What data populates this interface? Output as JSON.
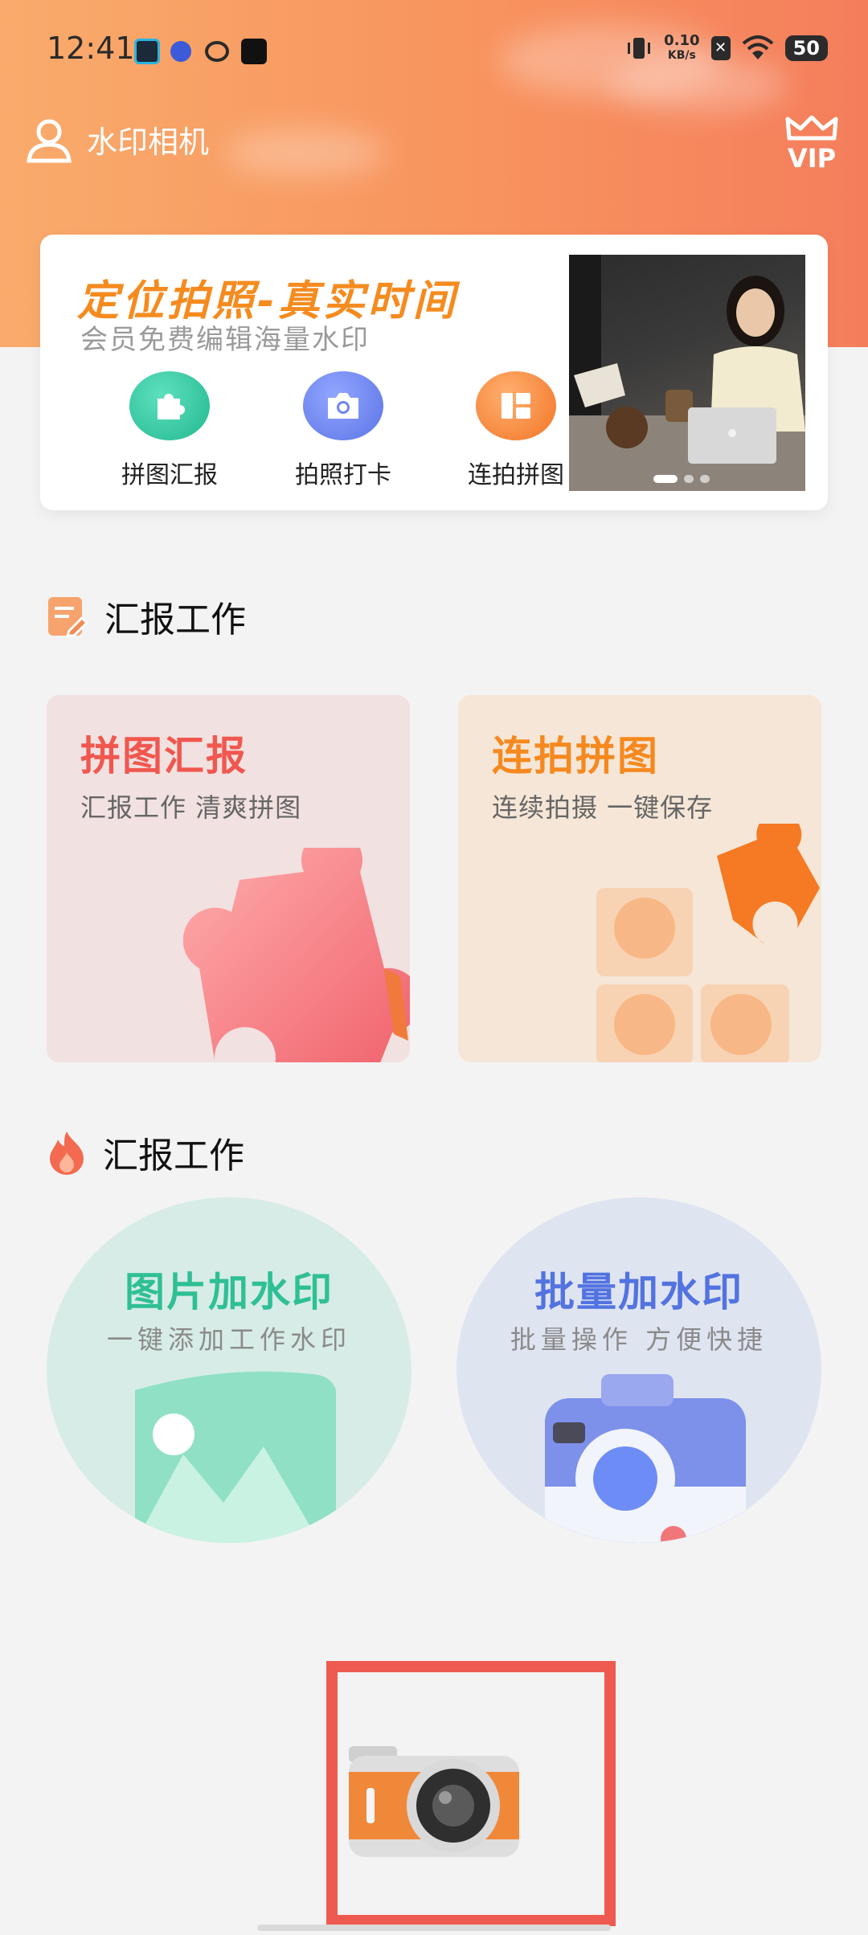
{
  "status_bar": {
    "time": "12:41",
    "net_speed_value": "0.10",
    "net_speed_unit": "KB/s",
    "battery": "50"
  },
  "header": {
    "title": "水印相机",
    "vip_label": "VIP"
  },
  "banner": {
    "title": "定位拍照-真实时间",
    "subtitle": "会员免费编辑海量水印",
    "quick_actions": [
      {
        "label": "拼图汇报",
        "icon": "puzzle-icon",
        "color": "#2fc6a0"
      },
      {
        "label": "拍照打卡",
        "icon": "camera-icon",
        "color": "#6f86ef"
      },
      {
        "label": "连拍拼图",
        "icon": "layout-icon",
        "color": "#f58a3a"
      }
    ],
    "carousel_pages": 3,
    "carousel_active": 1
  },
  "section1": {
    "title": "汇报工作",
    "cards": [
      {
        "title": "拼图汇报",
        "subtitle": "汇报工作 清爽拼图",
        "title_color": "#f0574f"
      },
      {
        "title": "连拍拼图",
        "subtitle": "连续拍摄  一键保存",
        "title_color": "#f5891f"
      }
    ]
  },
  "section2": {
    "title": "汇报工作",
    "cards": [
      {
        "title": "图片加水印",
        "subtitle": "一键添加工作水印",
        "title_color": "#2fbf95"
      },
      {
        "title": "批量加水印",
        "subtitle": "批量操作 方便快捷",
        "title_color": "#5273e0"
      }
    ]
  },
  "bottom": {
    "camera_button": "camera-icon"
  }
}
